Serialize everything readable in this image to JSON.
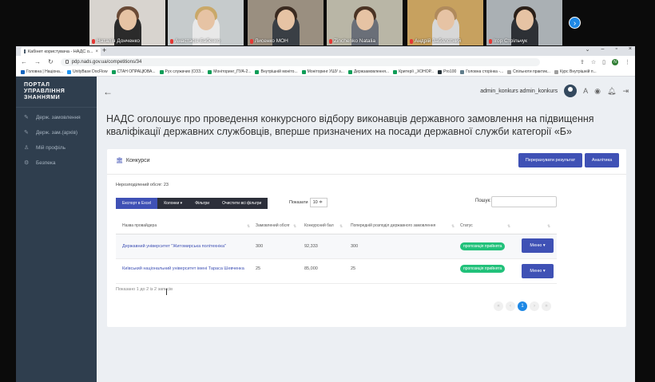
{
  "video_call": {
    "participants": [
      {
        "name": "Наталія Донченко"
      },
      {
        "name": "Анастасія Бабенко"
      },
      {
        "name": "Лисенко МОН"
      },
      {
        "name": "Zinchenko Natalia"
      },
      {
        "name": "Андрій Заболотний"
      },
      {
        "name": "Ігор Стрільчук"
      }
    ],
    "next_icon": "chevron-right-icon"
  },
  "browser": {
    "tab_title": "Кабінет користувача - НАДС о...",
    "url": "pdp.nads.gov.ua/competitions/34",
    "bookmarks": [
      "Головна | Націона...",
      "UnityBase DocFlow",
      "СТАН ОПРАЦЮВА...",
      "Рух служачих (ОЗЗ...",
      "Моніторинг_ПУА-2...",
      "Внутрішній моніто...",
      "Моніторинг УШУ з...",
      "Держзамовлення...",
      "Критерії _ХОНОР...",
      "Pro100",
      "Головна сторінка -...",
      "Спільноти практик...",
      "Курс Внутрішній п..."
    ],
    "profile_initial": "N"
  },
  "sidebar": {
    "logo_lines": [
      "ПОРТАЛ",
      "УПРАВЛІННЯ",
      "ЗНАННЯМИ"
    ],
    "items": [
      {
        "label": "Держ. замовлення",
        "icon": "wrench-icon"
      },
      {
        "label": "Держ. зам.(архів)",
        "icon": "wrench-icon"
      },
      {
        "label": "Мій профіль",
        "icon": "user-icon"
      },
      {
        "label": "Безпека",
        "icon": "gear-icon"
      }
    ]
  },
  "header": {
    "username": "admin_konkurs admin_konkurs"
  },
  "page": {
    "title": "НАДС оголошує про проведення конкурсного відбору виконавців державного замовлення на підвищення кваліфікації державних службовців, вперше призначених на посади державної служби категорії «Б»"
  },
  "card": {
    "title": "Конкурси",
    "recalc_button": "Перерахувати результат",
    "analytics_button": "Аналітика",
    "undistributed": "Нерозподілений обсяг: 23",
    "toolbar": {
      "export": "Експорт в Excel",
      "columns": "Колонки ▾",
      "filters": "Фільтри",
      "clear": "Очистити всі фільтри"
    },
    "show_label": "Показати",
    "show_value": "10 ≑",
    "search_label": "Пошук:",
    "columns": [
      "Назва провайдера",
      "Замовлений обсяг",
      "Конкурсний бал",
      "Попередній розподіл державного замовлення",
      "Статус"
    ],
    "rows": [
      {
        "provider": "Державний університет \"Житомирська політехніка\"",
        "ordered": "300",
        "score": "92,333",
        "prelim": "300",
        "status": "пропозиція прийнята",
        "menu": "Меню ▾"
      },
      {
        "provider": "Київський національний університет імені Тараса Шевченка",
        "ordered": "25",
        "score": "85,000",
        "prelim": "25",
        "status": "пропозиція прийнята",
        "menu": "Меню ▾"
      }
    ],
    "showing": "Показано 1 до 2 із 2 записів",
    "pager": {
      "first": "«",
      "prev": "‹",
      "current": "1",
      "next": "›",
      "last": "»"
    }
  },
  "colors": {
    "sidebar_bg": "#2f3e4e",
    "accent": "#3f51b5",
    "status_green": "#21c17a",
    "page_bg": "#eceff3"
  }
}
